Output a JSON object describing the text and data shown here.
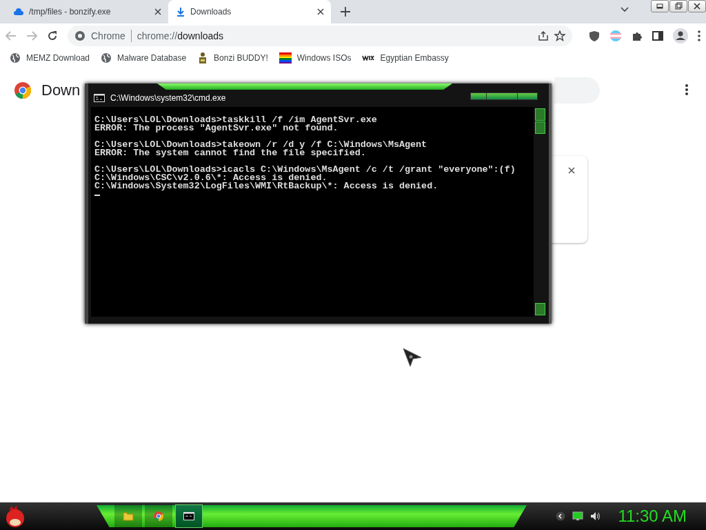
{
  "browser": {
    "tabs": [
      {
        "title": "/tmp/files - bonzify.exe",
        "kind": "cloud",
        "selected": false
      },
      {
        "title": "Downloads",
        "kind": "download",
        "selected": true
      }
    ],
    "omnibox": {
      "chip": "Chrome",
      "scheme": "chrome://",
      "path": "downloads"
    },
    "bookmarks": [
      {
        "label": "MEMZ Download",
        "kind": "globe"
      },
      {
        "label": "Malware Database",
        "kind": "globe"
      },
      {
        "label": "Bonzi BUDDY!",
        "kind": "figure"
      },
      {
        "label": "Windows ISOs",
        "kind": "rainbow"
      },
      {
        "label": "Egyptian Embassy",
        "kind": "wix"
      }
    ],
    "page": {
      "heading": "Down"
    }
  },
  "console": {
    "title": "C:\\Windows\\system32\\cmd.exe",
    "blocks": [
      [
        "C:\\Users\\LOL\\Downloads>taskkill /f /im AgentSvr.exe",
        "ERROR: The process \"AgentSvr.exe\" not found."
      ],
      [
        "C:\\Users\\LOL\\Downloads>takeown /r /d y /f C:\\Windows\\MsAgent",
        "ERROR: The system cannot find the file specified."
      ],
      [
        "C:\\Users\\LOL\\Downloads>icacls C:\\Windows\\MsAgent /c /t /grant \"everyone\":(f)",
        "C:\\Windows\\CSC\\v2.0.6\\*: Access is denied.",
        "C:\\Windows\\System32\\LogFiles\\WMI\\RtBackup\\*: Access is denied."
      ]
    ]
  },
  "taskbar": {
    "apps": [
      {
        "kind": "folder",
        "selected": false
      },
      {
        "kind": "chrome",
        "selected": false
      },
      {
        "kind": "cmd",
        "selected": true
      }
    ],
    "clock": "11:30 AM"
  }
}
